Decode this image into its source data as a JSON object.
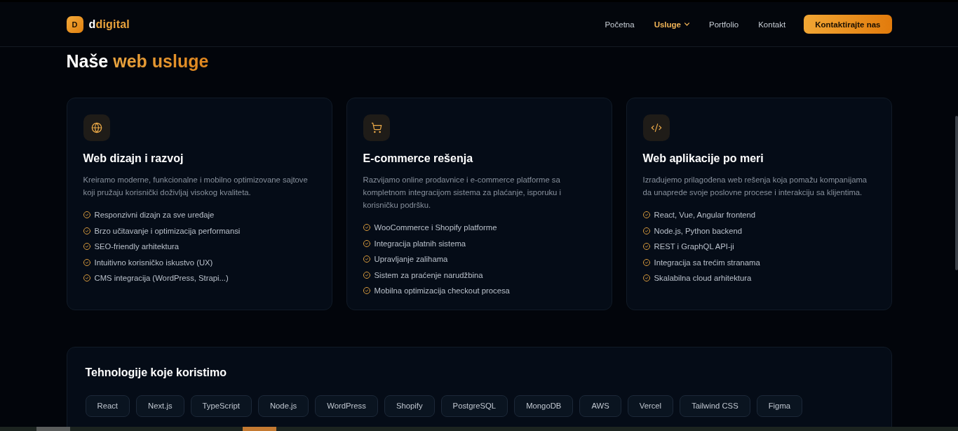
{
  "header": {
    "logo": {
      "mark": "D",
      "name_lead": "d",
      "name_accent": "digital"
    },
    "nav": [
      {
        "label": "Početna",
        "selected": false,
        "dropdown": false
      },
      {
        "label": "Usluge",
        "selected": true,
        "dropdown": true
      },
      {
        "label": "Portfolio",
        "selected": false,
        "dropdown": false
      },
      {
        "label": "Kontakt",
        "selected": false,
        "dropdown": false
      }
    ],
    "cta": "Kontaktirajte nas"
  },
  "services": {
    "heading": {
      "lead": "Naše",
      "accent": "web usluge"
    },
    "cards": [
      {
        "kind": "globe",
        "title": "Web dizajn i razvoj",
        "description": "Kreiramo moderne, funkcionalne i mobilno optimizovane sajtove koji pružaju korisnički doživljaj visokog kvaliteta.",
        "features": [
          "Responzivni dizajn za sve uređaje",
          "Brzo učitavanje i optimizacija performansi",
          "SEO-friendly arhitektura",
          "Intuitivno korisničko iskustvo (UX)",
          "CMS integracija (WordPress, Strapi...)"
        ]
      },
      {
        "kind": "cart",
        "title": "E-commerce rešenja",
        "description": "Razvijamo online prodavnice i e-commerce platforme sa kompletnom integracijom sistema za plaćanje, isporuku i korisničku podršku.",
        "features": [
          "WooCommerce i Shopify platforme",
          "Integracija platnih sistema",
          "Upravljanje zalihama",
          "Sistem za praćenje narudžbina",
          "Mobilna optimizacija checkout procesa"
        ]
      },
      {
        "kind": "code",
        "title": "Web aplikacije po meri",
        "description": "Izrađujemo prilagođena web rešenja koja pomažu kompanijama da unaprede svoje poslovne procese i interakciju sa klijentima.",
        "features": [
          "React, Vue, Angular frontend",
          "Node.js, Python backend",
          "REST i GraphQL API-ji",
          "Integracija sa trećim stranama",
          "Skalabilna cloud arhitektura"
        ]
      }
    ]
  },
  "technologies": {
    "title": "Tehnologije koje koristimo",
    "tags": [
      "React",
      "Next.js",
      "TypeScript",
      "Node.js",
      "WordPress",
      "Shopify",
      "PostgreSQL",
      "MongoDB",
      "AWS",
      "Vercel",
      "Tailwind CSS",
      "Figma"
    ]
  },
  "taskbar": {
    "items": [
      {
        "active": false
      },
      {
        "active": true
      }
    ]
  }
}
